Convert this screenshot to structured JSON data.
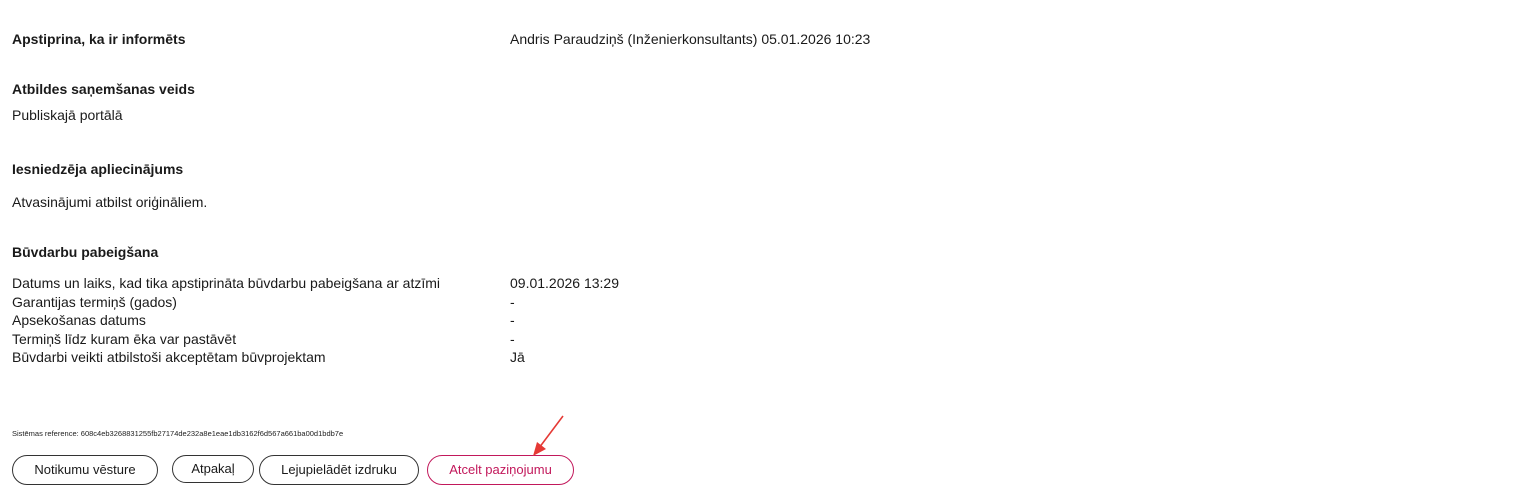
{
  "confirmation": {
    "label": "Apstiprina, ka ir informēts",
    "value": "Andris Paraudziņš (Inženierkonsultants) 05.01.2026 10:23"
  },
  "response_type": {
    "heading": "Atbildes saņemšanas veids",
    "value": "Publiskajā portālā"
  },
  "submitter_statement": {
    "heading": "Iesniedzēja apliecinājums",
    "value": "Atvasinājumi atbilst oriģināliem."
  },
  "completion": {
    "heading": "Būvdarbu pabeigšana",
    "rows": [
      {
        "label": "Datums un laiks, kad tika apstiprināta būvdarbu pabeigšana ar atzīmi",
        "value": "09.01.2026 13:29"
      },
      {
        "label": "Garantijas termiņš (gados)",
        "value": "-"
      },
      {
        "label": "Apsekošanas datums",
        "value": "-"
      },
      {
        "label": "Termiņš līdz kuram ēka var pastāvēt",
        "value": "-"
      },
      {
        "label": "Būvdarbi veikti atbilstoši akceptētam būvprojektam",
        "value": "Jā"
      }
    ]
  },
  "system_reference": "Sistēmas reference: 608c4eb3268831255fb27174de232a8e1eae1db3162f6d567a661ba00d1bdb7e",
  "buttons": {
    "history": "Notikumu vēsture",
    "back": "Atpakaļ",
    "download": "Lejupielādēt izdruku",
    "cancel": "Atcelt paziņojumu"
  },
  "colors": {
    "cancel_accent": "#c2185b",
    "annotation_arrow": "#e53935"
  }
}
